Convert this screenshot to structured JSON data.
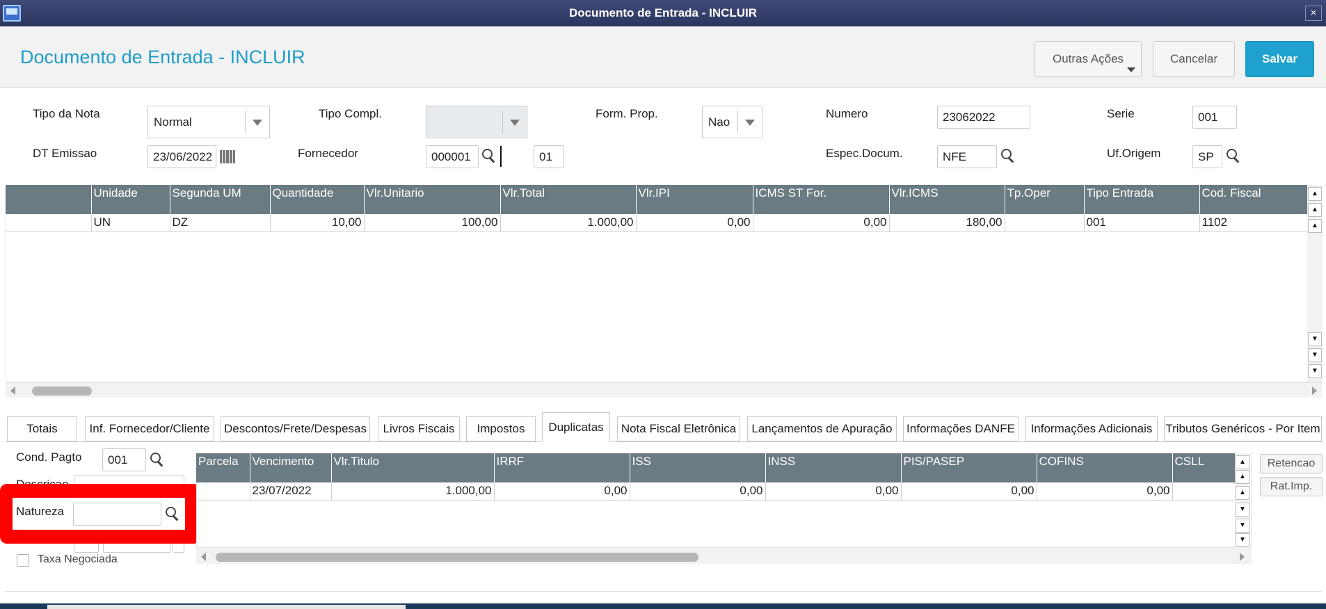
{
  "window": {
    "title": "Documento de Entrada - INCLUIR",
    "close_label": "×"
  },
  "header": {
    "title": "Documento de Entrada - INCLUIR",
    "outras_acoes": "Outras Ações",
    "cancelar": "Cancelar",
    "salvar": "Salvar"
  },
  "form": {
    "tipo_nota": {
      "label": "Tipo da Nota",
      "value": "Normal"
    },
    "tipo_compl": {
      "label": "Tipo Compl.",
      "value": ""
    },
    "form_prop": {
      "label": "Form. Prop.",
      "value": "Nao"
    },
    "numero": {
      "label": "Numero",
      "value": "23062022"
    },
    "serie": {
      "label": "Serie",
      "value": "001"
    },
    "dt_emissao": {
      "label": "DT Emissao",
      "value": "23/06/2022"
    },
    "fornecedor": {
      "label": "Fornecedor",
      "code": "000001",
      "loja": "01"
    },
    "espec_docum": {
      "label": "Espec.Docum.",
      "value": "NFE"
    },
    "uf_origem": {
      "label": "Uf.Origem",
      "value": "SP"
    }
  },
  "items_grid": {
    "columns": [
      "Unidade",
      "Segunda UM",
      "Quantidade",
      "Vlr.Unitario",
      "Vlr.Total",
      "Vlr.IPI",
      "ICMS ST For.",
      "Vlr.ICMS",
      "Tp.Oper",
      "Tipo Entrada",
      "Cod. Fiscal"
    ],
    "rows": [
      [
        "UN",
        "DZ",
        "10,00",
        "100,00",
        "1.000,00",
        "0,00",
        "0,00",
        "180,00",
        "",
        "001",
        "1102"
      ]
    ]
  },
  "tabs": [
    "Totais",
    "Inf. Fornecedor/Cliente",
    "Descontos/Frete/Despesas",
    "Livros Fiscais",
    "Impostos",
    "Duplicatas",
    "Nota Fiscal Eletrônica",
    "Lançamentos de Apuração",
    "Informações DANFE",
    "Informações Adicionais",
    "Tributos Genéricos - Por Item"
  ],
  "active_tab": "Duplicatas",
  "duplicatas": {
    "cond_pagto": {
      "label": "Cond. Pagto",
      "value": "001"
    },
    "descricao": {
      "label": "Descricao",
      "value": ""
    },
    "natureza": {
      "label": "Natureza",
      "value": ""
    },
    "taxa_negociada": {
      "label": "Taxa Negociada",
      "checked": false
    },
    "grid": {
      "columns": [
        "Parcela",
        "Vencimento",
        "Vlr.Titulo",
        "IRRF",
        "ISS",
        "INSS",
        "PIS/PASEP",
        "COFINS",
        "CSLL"
      ],
      "rows": [
        [
          "",
          "23/07/2022",
          "1.000,00",
          "0,00",
          "0,00",
          "0,00",
          "0,00",
          "0,00",
          ""
        ]
      ]
    },
    "retencao": "Retencao",
    "rat_imp": "Rat.Imp."
  },
  "colors": {
    "accent": "#1e9dc8",
    "grid_header": "#6b7b83",
    "highlight": "#ff0000"
  }
}
